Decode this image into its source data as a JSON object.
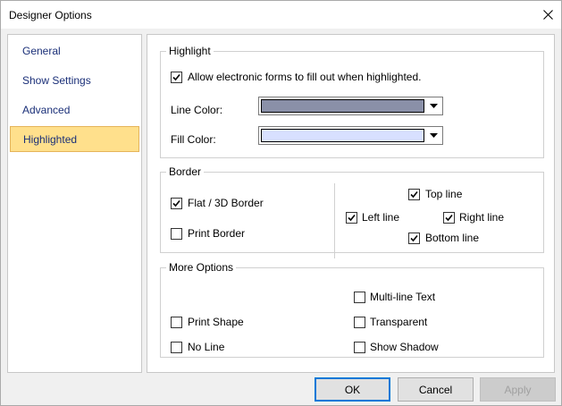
{
  "window": {
    "title": "Designer Options"
  },
  "sidebar": {
    "items": [
      {
        "label": "General",
        "selected": false
      },
      {
        "label": "Show Settings",
        "selected": false
      },
      {
        "label": "Advanced",
        "selected": false
      },
      {
        "label": "Highlighted",
        "selected": true
      }
    ]
  },
  "highlight": {
    "legend": "Highlight",
    "allow_forms": {
      "label": "Allow electronic forms to fill out when highlighted.",
      "checked": true
    },
    "line_color": {
      "label": "Line Color:",
      "value": "#8a90a8"
    },
    "fill_color": {
      "label": "Fill Color:",
      "value": "#d8e0ff"
    }
  },
  "border": {
    "legend": "Border",
    "flat_3d": {
      "label": "Flat / 3D Border",
      "checked": true
    },
    "print_border": {
      "label": "Print Border",
      "checked": false
    },
    "top_line": {
      "label": "Top line",
      "checked": true
    },
    "left_line": {
      "label": "Left line",
      "checked": true
    },
    "right_line": {
      "label": "Right line",
      "checked": true
    },
    "bottom_line": {
      "label": "Bottom line",
      "checked": true
    }
  },
  "more_options": {
    "legend": "More Options",
    "multiline_text": {
      "label": "Multi-line Text",
      "checked": false
    },
    "print_shape": {
      "label": "Print Shape",
      "checked": false
    },
    "transparent": {
      "label": "Transparent",
      "checked": false
    },
    "no_line": {
      "label": "No Line",
      "checked": false
    },
    "show_shadow": {
      "label": "Show Shadow",
      "checked": false
    }
  },
  "footer": {
    "ok": "OK",
    "cancel": "Cancel",
    "apply": "Apply"
  }
}
